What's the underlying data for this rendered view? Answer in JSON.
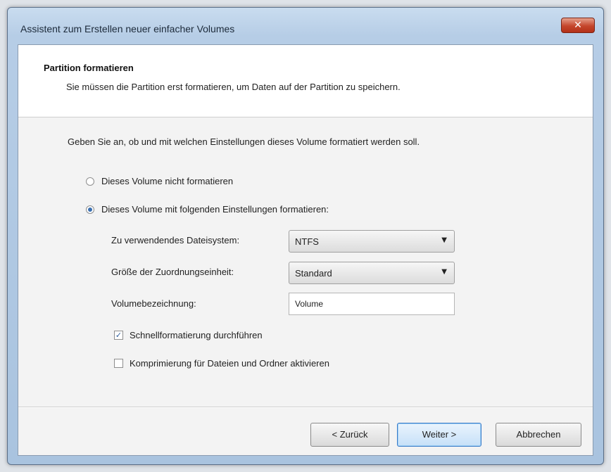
{
  "window": {
    "title": "Assistent zum Erstellen neuer einfacher Volumes",
    "close_label": "✕"
  },
  "header": {
    "title": "Partition formatieren",
    "description": "Sie müssen die Partition erst formatieren, um Daten auf der Partition zu speichern."
  },
  "body": {
    "intro": "Geben Sie an, ob und mit welchen Einstellungen dieses Volume formatiert werden soll.",
    "options": [
      {
        "label": "Dieses Volume nicht formatieren",
        "checked": false
      },
      {
        "label": "Dieses Volume mit folgenden Einstellungen formatieren:",
        "checked": true
      }
    ],
    "filesystem": {
      "label": "Zu verwendendes Dateisystem:",
      "value": "NTFS"
    },
    "allocation": {
      "label": "Größe der Zuordnungseinheit:",
      "value": "Standard"
    },
    "volume_label": {
      "label": "Volumebezeichnung:",
      "value": "Volume"
    },
    "quick_format": {
      "label": "Schnellformatierung durchführen",
      "checked": true
    },
    "compression": {
      "label": "Komprimierung für Dateien und Ordner aktivieren",
      "checked": false
    }
  },
  "buttons": {
    "back": "< Zurück",
    "next": "Weiter >",
    "cancel": "Abbrechen"
  },
  "icons": {
    "dropdown": "chevron-down-icon",
    "check": "checkmark-icon"
  }
}
